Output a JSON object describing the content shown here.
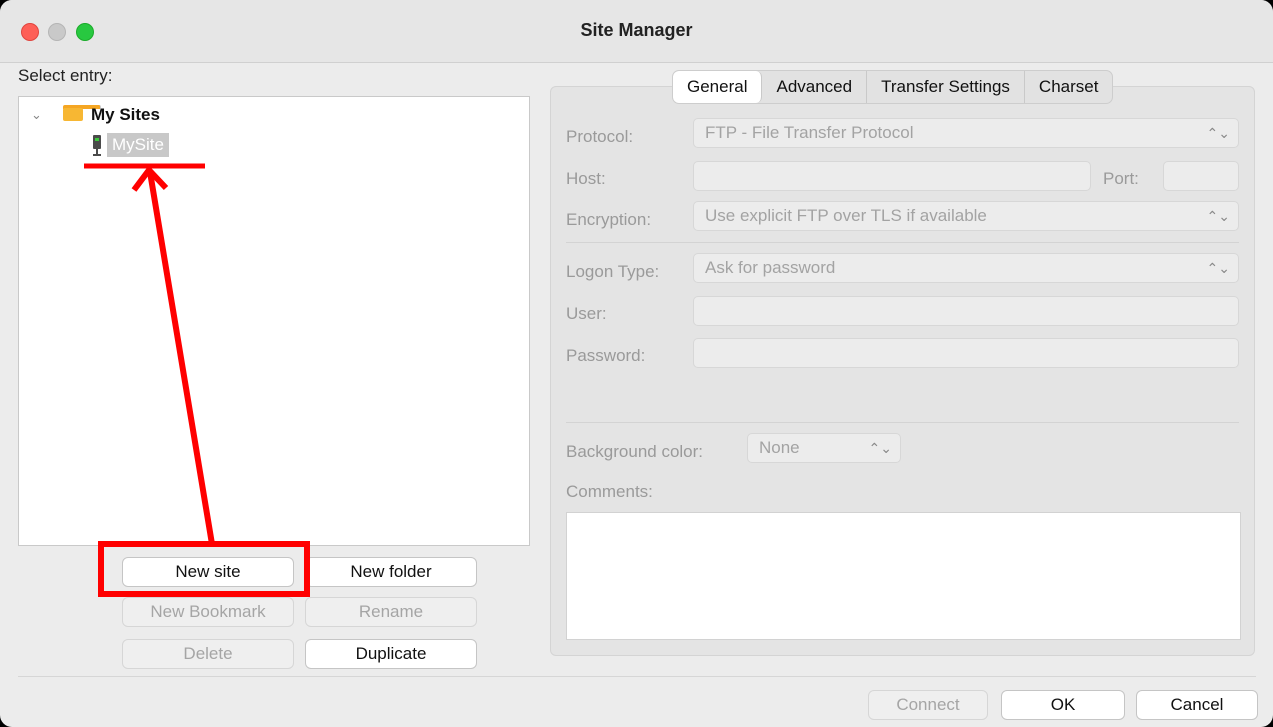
{
  "window": {
    "title": "Site Manager"
  },
  "left": {
    "select_entry_label": "Select entry:",
    "tree": {
      "root_label": "My Sites",
      "children": [
        "MySite"
      ]
    },
    "buttons": {
      "new_site": "New site",
      "new_folder": "New folder",
      "new_bookmark": "New Bookmark",
      "rename": "Rename",
      "delete": "Delete",
      "duplicate": "Duplicate"
    }
  },
  "tabs": [
    "General",
    "Advanced",
    "Transfer Settings",
    "Charset"
  ],
  "general": {
    "protocol_label": "Protocol:",
    "protocol_value": "FTP - File Transfer Protocol",
    "host_label": "Host:",
    "host_value": "",
    "port_label": "Port:",
    "port_value": "",
    "encryption_label": "Encryption:",
    "encryption_value": "Use explicit FTP over TLS if available",
    "logon_type_label": "Logon Type:",
    "logon_type_value": "Ask for password",
    "user_label": "User:",
    "user_value": "",
    "password_label": "Password:",
    "password_value": "",
    "background_color_label": "Background color:",
    "background_color_value": "None",
    "comments_label": "Comments:",
    "comments_value": ""
  },
  "footer": {
    "connect": "Connect",
    "ok": "OK",
    "cancel": "Cancel"
  },
  "icons": {
    "folder": "folder-icon",
    "site": "server-icon",
    "expand": "chevron-down-icon",
    "select_arrows": "updown-chevron-icon"
  },
  "colors": {
    "annotation": "#ff0000",
    "close": "#fe5f57",
    "maximize": "#28c840",
    "folder": "#f7b733"
  }
}
